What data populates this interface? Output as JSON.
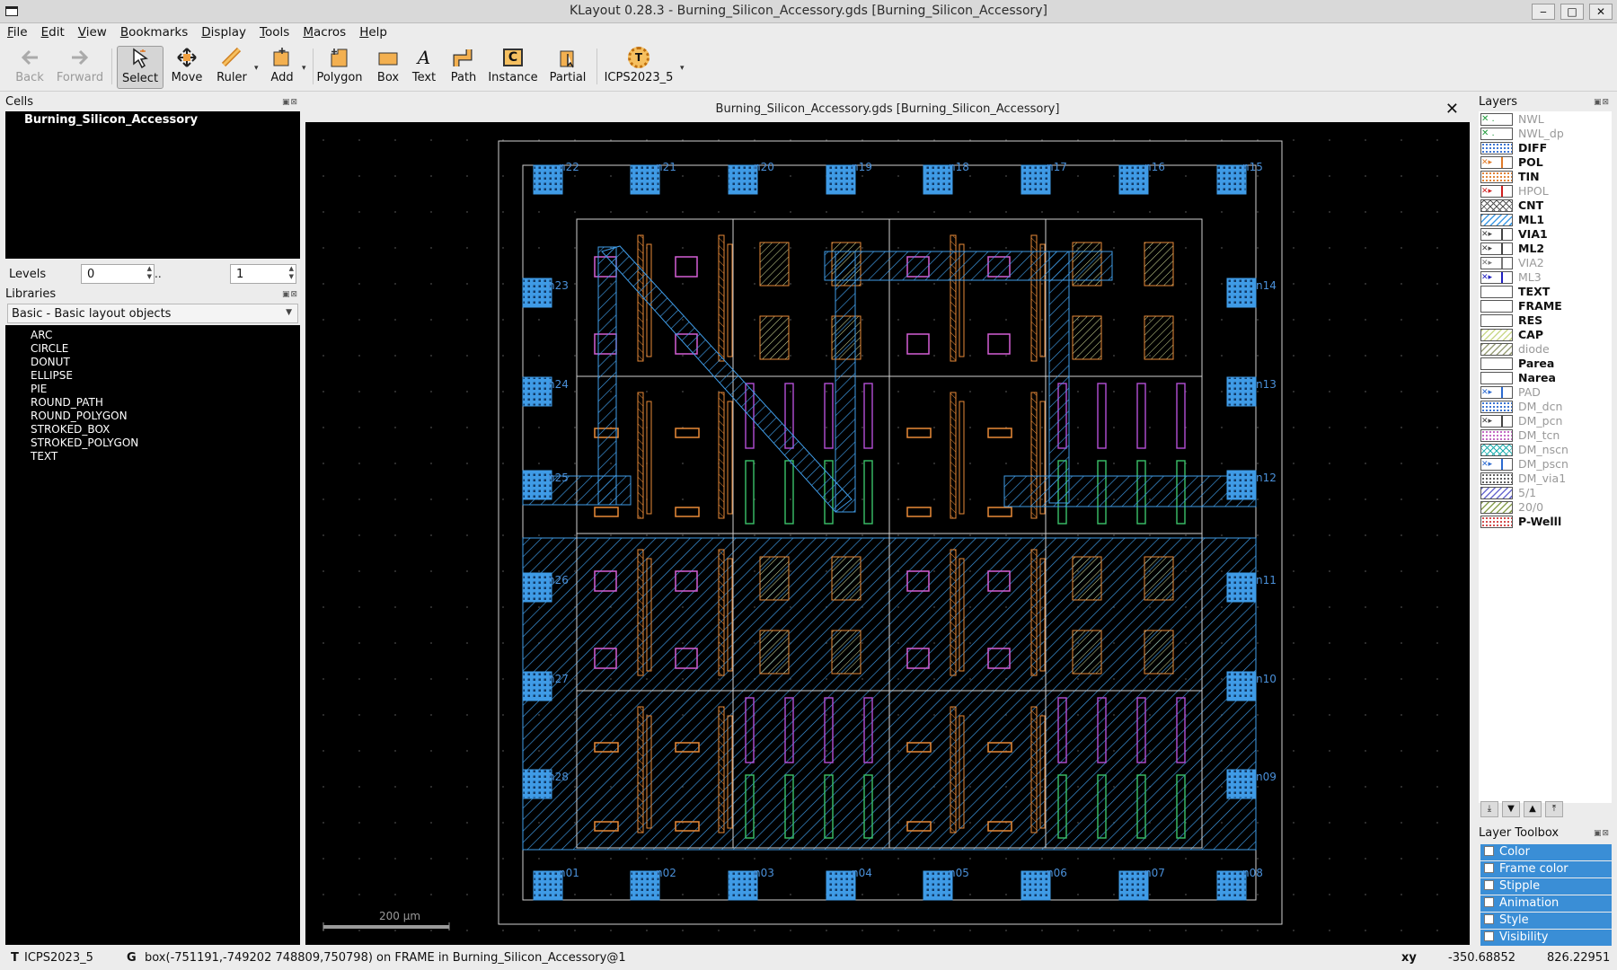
{
  "window": {
    "title": "KLayout 0.28.3 - Burning_Silicon_Accessory.gds [Burning_Silicon_Accessory]",
    "min": "‒",
    "max": "□",
    "close": "✕"
  },
  "menu": [
    "File",
    "Edit",
    "View",
    "Bookmarks",
    "Display",
    "Tools",
    "Macros",
    "Help"
  ],
  "toolbar": {
    "back": "Back",
    "forward": "Forward",
    "select": "Select",
    "move": "Move",
    "ruler": "Ruler",
    "add": "Add",
    "polygon": "Polygon",
    "box": "Box",
    "text": "Text",
    "path": "Path",
    "instance": "Instance",
    "partial": "Partial",
    "tech": "ICPS2023_5",
    "instance_glyph": "C",
    "tech_glyph": "T"
  },
  "cells": {
    "header": "Cells",
    "top_cell": "Burning_Silicon_Accessory"
  },
  "levels": {
    "label": "Levels",
    "from": "0",
    "sep": "..",
    "to": "1"
  },
  "libraries": {
    "header": "Libraries",
    "selected": "Basic - Basic layout objects",
    "items": [
      "ARC",
      "CIRCLE",
      "DONUT",
      "ELLIPSE",
      "PIE",
      "ROUND_PATH",
      "ROUND_POLYGON",
      "STROKED_BOX",
      "STROKED_POLYGON",
      "TEXT"
    ]
  },
  "view": {
    "tab_title": "Burning_Silicon_Accessory.gds [Burning_Silicon_Accessory]",
    "scale_label": "200 µm",
    "pads_top": [
      "n22",
      "n21",
      "n20",
      "n19",
      "n18",
      "n17",
      "n16",
      "n15"
    ],
    "pads_bottom": [
      "n01",
      "n02",
      "n03",
      "n04",
      "n05",
      "n06",
      "n07",
      "n08"
    ],
    "pads_left": [
      "n23",
      "n24",
      "n25",
      "n26",
      "n27",
      "n28"
    ],
    "pads_right": [
      "n14",
      "n13",
      "n12",
      "n11",
      "n10",
      "n09"
    ],
    "pad_color": "#3f9be6"
  },
  "layers": {
    "header": "Layers",
    "items": [
      {
        "name": "NWL",
        "color": "#1f9a3a",
        "style": "x",
        "dim": true
      },
      {
        "name": "NWL_dp",
        "color": "#1f9a3a",
        "style": "x",
        "dim": true
      },
      {
        "name": "DIFF",
        "color": "#2c6ad0",
        "style": "dots",
        "dim": false
      },
      {
        "name": "POL",
        "color": "#e07a28",
        "style": "arrow",
        "dim": false
      },
      {
        "name": "TIN",
        "color": "#e07a28",
        "style": "dots",
        "dim": false
      },
      {
        "name": "HPOL",
        "color": "#d02020",
        "style": "arrow",
        "dim": true
      },
      {
        "name": "CNT",
        "color": "#555555",
        "style": "cross",
        "dim": false
      },
      {
        "name": "ML1",
        "color": "#3f9be6",
        "style": "hatch",
        "dim": false
      },
      {
        "name": "VIA1",
        "color": "#444444",
        "style": "arrow",
        "dim": false
      },
      {
        "name": "ML2",
        "color": "#444444",
        "style": "arrow",
        "dim": false
      },
      {
        "name": "VIA2",
        "color": "#777777",
        "style": "arrow",
        "dim": true
      },
      {
        "name": "ML3",
        "color": "#2020c0",
        "style": "arrow",
        "dim": true
      },
      {
        "name": "TEXT",
        "color": "#222222",
        "style": "empty",
        "dim": false
      },
      {
        "name": "FRAME",
        "color": "#222222",
        "style": "empty",
        "dim": false
      },
      {
        "name": "RES",
        "color": "#7a3aa0",
        "style": "empty",
        "dim": false
      },
      {
        "name": "CAP",
        "color": "#cbd98a",
        "style": "hatch",
        "dim": false
      },
      {
        "name": "diode",
        "color": "#9aa07a",
        "style": "hatch",
        "dim": true
      },
      {
        "name": "Parea",
        "color": "#a040c0",
        "style": "empty",
        "dim": false
      },
      {
        "name": "Narea",
        "color": "#30a040",
        "style": "empty",
        "dim": false
      },
      {
        "name": "PAD",
        "color": "#2c6ad0",
        "style": "arrow",
        "dim": true
      },
      {
        "name": "DM_dcn",
        "color": "#2c6ad0",
        "style": "dots",
        "dim": true
      },
      {
        "name": "DM_pcn",
        "color": "#444444",
        "style": "arrow",
        "dim": true
      },
      {
        "name": "DM_tcn",
        "color": "#c060c0",
        "style": "dots",
        "dim": true
      },
      {
        "name": "DM_nscn",
        "color": "#20b0b0",
        "style": "cross",
        "dim": true
      },
      {
        "name": "DM_pscn",
        "color": "#2c6ad0",
        "style": "arrow",
        "dim": true
      },
      {
        "name": "DM_via1",
        "color": "#555555",
        "style": "dots",
        "dim": true
      },
      {
        "name": "5/1",
        "color": "#6a6ad0",
        "style": "hatch",
        "dim": true
      },
      {
        "name": "20/0",
        "color": "#8aa050",
        "style": "hatch",
        "dim": true
      },
      {
        "name": "P-Welll",
        "color": "#d04040",
        "style": "dots",
        "dim": false
      }
    ]
  },
  "layer_toolbox": {
    "header": "Layer Toolbox",
    "items": [
      "Color",
      "Frame color",
      "Stipple",
      "Animation",
      "Style",
      "Visibility"
    ]
  },
  "status": {
    "tech_prefix": "T",
    "tech": "ICPS2023_5",
    "grid_prefix": "G",
    "message": "box(-751191,-749202 748809,750798) on FRAME in Burning_Silicon_Accessory@1",
    "xy_label": "xy",
    "x": "-350.68852",
    "y": "826.22951"
  }
}
